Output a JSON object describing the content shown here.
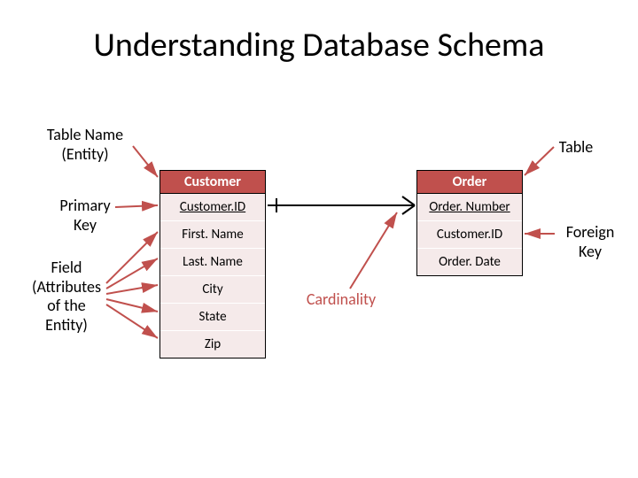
{
  "title": "Understanding Database Schema",
  "labels": {
    "tableName": "Table Name\n(Entity)",
    "primaryKey": "Primary\nKey",
    "field": "Field\n(Attributes\nof the\nEntity)",
    "table": "Table",
    "foreignKey": "Foreign\nKey",
    "cardinality": "Cardinality"
  },
  "customer": {
    "header": "Customer",
    "rows": [
      "Customer.ID",
      "First. Name",
      "Last. Name",
      "City",
      "State",
      "Zip"
    ]
  },
  "order": {
    "header": "Order",
    "rows": [
      "Order. Number",
      "Customer.ID",
      "Order. Date"
    ]
  }
}
